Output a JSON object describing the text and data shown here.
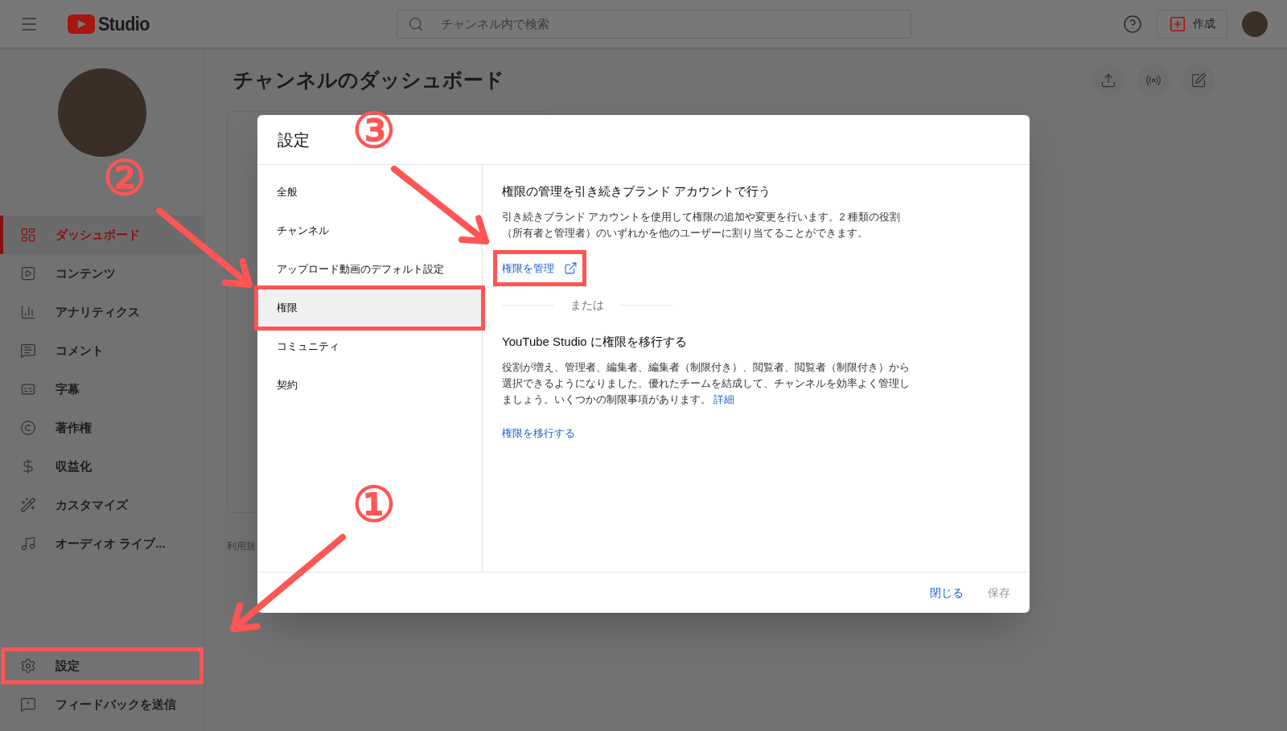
{
  "header": {
    "logo_text": "Studio",
    "search": {
      "placeholder": "チャンネル内で検索"
    },
    "create_button": "作成"
  },
  "sidebar": {
    "items": [
      {
        "kind": "dashboard",
        "label": "ダッシュボード",
        "selected": true
      },
      {
        "kind": "content",
        "label": "コンテンツ",
        "selected": false
      },
      {
        "kind": "analytics",
        "label": "アナリティクス",
        "selected": false
      },
      {
        "kind": "comments",
        "label": "コメント",
        "selected": false
      },
      {
        "kind": "subtitles",
        "label": "字幕",
        "selected": false
      },
      {
        "kind": "copyright",
        "label": "著作権",
        "selected": false
      },
      {
        "kind": "monetization",
        "label": "収益化",
        "selected": false
      },
      {
        "kind": "customize",
        "label": "カスタマイズ",
        "selected": false
      },
      {
        "kind": "audio",
        "label": "オーディオ ライブ...",
        "selected": false
      }
    ],
    "footer_items": [
      {
        "kind": "settings",
        "label": "設定",
        "selected": false,
        "highlighted": true
      },
      {
        "kind": "feedback",
        "label": "フィードバックを送信",
        "selected": false,
        "highlighted": false
      }
    ]
  },
  "main": {
    "title": "チャンネルのダッシュボード",
    "footer_text": "利用規"
  },
  "dialog": {
    "title": "設定",
    "nav": [
      {
        "label": "全般",
        "selected": false,
        "highlighted": false
      },
      {
        "label": "チャンネル",
        "selected": false,
        "highlighted": false
      },
      {
        "label": "アップロード動画のデフォルト設定",
        "selected": false,
        "highlighted": false
      },
      {
        "label": "権限",
        "selected": true,
        "highlighted": true
      },
      {
        "label": "コミュニティ",
        "selected": false,
        "highlighted": false
      },
      {
        "label": "契約",
        "selected": false,
        "highlighted": false
      }
    ],
    "content": {
      "heading": "権限の管理を引き続きブランド アカウントで行う",
      "description": "引き続きブランド アカウントを使用して権限の追加や変更を行います。2 種類の役割（所有者と管理者）のいずれかを他のユーザーに割り当てることができます。",
      "manage_link": {
        "label": "権限を管理",
        "highlighted": true
      },
      "divider_label": "または",
      "heading_2": "YouTube Studio に権限を移行する",
      "description_2": "役割が増え、管理者、編集者、編集者（制限付き）、閲覧者、閲覧者（制限付き）から選択できるようになりました。優れたチームを結成して、チャンネルを効率よく管理しましょう。いくつかの制限事項があります。",
      "details_link": "詳細",
      "migrate_link": "権限を移行する"
    },
    "buttons": [
      {
        "label": "閉じる",
        "disabled": false
      },
      {
        "label": "保存",
        "disabled": true
      }
    ]
  },
  "annotations": [
    {
      "label": "③"
    },
    {
      "label": "②"
    },
    {
      "label": "①"
    }
  ]
}
